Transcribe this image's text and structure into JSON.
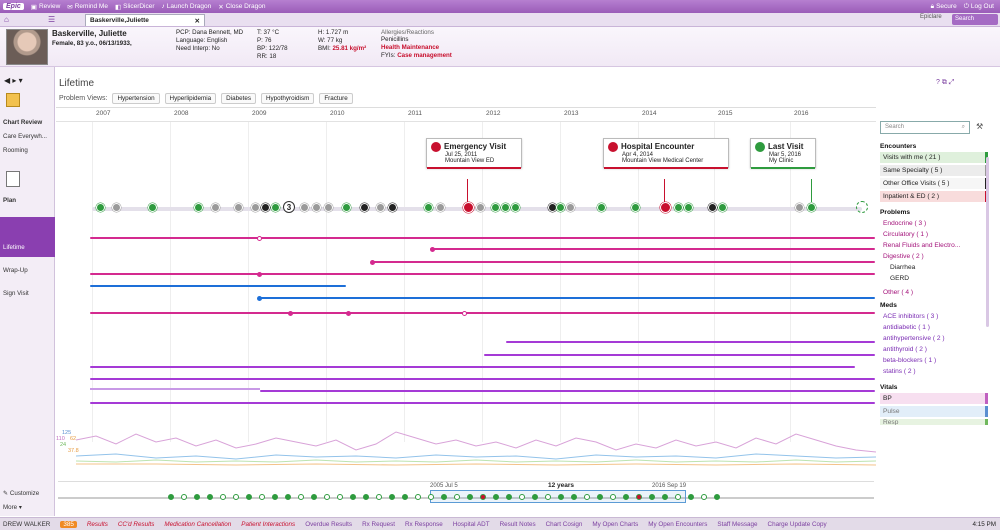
{
  "topbar": {
    "app": "Epic",
    "items": [
      "Review",
      "Remind Me",
      "SlicerDicer",
      "Launch Dragon",
      "Close Dragon"
    ],
    "right": [
      "Secure",
      "Log Out"
    ],
    "search_placeholder": "Search",
    "user": "Epiclare"
  },
  "tab": {
    "patient": "Baskerville,Juliette"
  },
  "patient": {
    "name": "Baskerville, Juliette",
    "demo": "Female, 83 y.o., 06/13/1933,",
    "pcp": "PCP: Dana Bennett, MD",
    "language": "Language: English",
    "interp": "Need Interp: No",
    "t": "T: 37 °C",
    "p": "P: 76",
    "bp": "BP: 122/78",
    "rr": "RR: 18",
    "h": "H: 1.727 m",
    "w": "W: 77 kg",
    "bmi_label": "BMI:",
    "bmi": "25.81 kg/m²",
    "allergies_label": "Allergies/Reactions",
    "allergies": "Penicillins",
    "health": "Health Maintenance",
    "fyi_label": "FYIs:",
    "fyi": "Case management"
  },
  "sidebar": {
    "chart_review": "Chart Review",
    "care": "Care Everywh...",
    "rooming": "Rooming",
    "plan": "Plan",
    "lifetime": "Lifetime",
    "wrapup": "Wrap-Up",
    "sign": "Sign Visit",
    "customize": "Customize",
    "more": "More"
  },
  "main": {
    "title": "Lifetime",
    "views_label": "Problem Views:",
    "views": [
      "Hypertension",
      "Hyperlipidemia",
      "Diabetes",
      "Hypothyroidism",
      "Fracture"
    ],
    "years": [
      "2007",
      "2008",
      "2009",
      "2010",
      "2011",
      "2012",
      "2013",
      "2014",
      "2015",
      "2016"
    ],
    "search_placeholder": "Search"
  },
  "cards": [
    {
      "title": "Emergency Visit",
      "date": "Jul 25, 2011",
      "place": "Mountain View ED",
      "color": "#c8102e"
    },
    {
      "title": "Hospital Encounter",
      "date": "Apr 4, 2014",
      "place": "Mountain View Medical Center",
      "color": "#c8102e"
    },
    {
      "title": "Last Visit",
      "date": "Mar 5, 2016",
      "place": "My Clinic",
      "color": "#2e9b3e"
    }
  ],
  "encounter_count_badge": "3",
  "right_panel": {
    "encounters_title": "Encounters",
    "encounters": [
      {
        "label": "Visits with me",
        "count": "( 21 )",
        "color": "#2e9b3e"
      },
      {
        "label": "Same Specialty",
        "count": "( 5 )",
        "color": "#9a9a9a"
      },
      {
        "label": "Other Office Visits",
        "count": "( 5 )",
        "color": "#222222"
      },
      {
        "label": "Inpatient & ED",
        "count": "( 2 )",
        "color": "#c8102e"
      }
    ],
    "problems_title": "Problems",
    "problems": [
      "Endocrine ( 3 )",
      "Circulatory ( 1 )",
      "Renal Fluids and Electro...",
      "Digestive ( 2 )",
      "Diarrhea",
      "GERD",
      "Other ( 4 )"
    ],
    "meds_title": "Meds",
    "meds": [
      "ACE inhibitors ( 3 )",
      "antidiabetic ( 1 )",
      "antihypertensive ( 2 )",
      "antithyroid ( 2 )",
      "beta-blockers ( 1 )",
      "statins ( 2 )"
    ],
    "vitals_title": "Vitals",
    "vitals": [
      "BP",
      "Pulse",
      "Resp"
    ]
  },
  "vitals_axis": [
    "125",
    "110",
    "62",
    "24",
    "37.8"
  ],
  "scrubber": {
    "start": "2005 Jul 5",
    "span": "12 years",
    "end": "2016 Sep 19"
  },
  "status": {
    "user": "DREW WALKER",
    "badge": "385",
    "links": [
      "Results",
      "CC'd Results",
      "Medication Cancellation",
      "Patient Interactions",
      "Overdue Results",
      "Rx Request",
      "Rx Response",
      "Hospital ADT",
      "Result Notes",
      "Chart Cosign",
      "My Open Charts",
      "My Open Encounters",
      "Staff Message",
      "Charge Update Copy"
    ],
    "time": "4:15 PM"
  }
}
